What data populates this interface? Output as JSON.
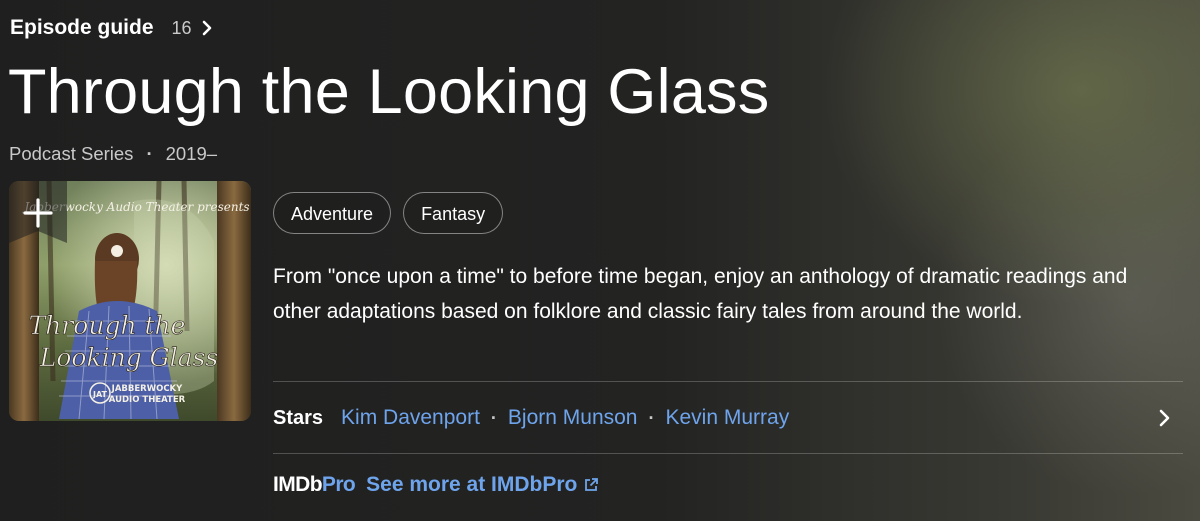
{
  "episode_guide": {
    "label": "Episode guide",
    "count": "16",
    "chevron_icon": "chevron-right-icon"
  },
  "title": "Through the Looking Glass",
  "meta": {
    "type": "Podcast Series",
    "separator": "·",
    "years": "2019–"
  },
  "poster": {
    "top_text": "Jabberwocky Audio Theater presents",
    "title_line1": "Through the",
    "title_line2": "Looking Glass",
    "logo_mark": "JAT",
    "brand_line1": "JABBERWOCKY",
    "brand_line2": "AUDIO THEATER",
    "add_icon": "plus-icon"
  },
  "genres": [
    "Adventure",
    "Fantasy"
  ],
  "plot": "From \"once upon a time\" to before time began, enjoy an anthology of dramatic readings and other adaptations based on folklore and classic fairy tales from around the world.",
  "stars": {
    "label": "Stars",
    "names": [
      "Kim Davenport",
      "Bjorn Munson",
      "Kevin Murray"
    ],
    "separator": "·",
    "chevron_icon": "chevron-right-icon"
  },
  "imdbpro": {
    "logo_imdb": "IMDb",
    "logo_pro": "Pro",
    "link_text": "See more at IMDbPro",
    "link_icon": "external-link-icon"
  },
  "colors": {
    "link": "#6ea4ec",
    "background": "#1f1f1f",
    "secondary_text": "#c9c9c9"
  }
}
